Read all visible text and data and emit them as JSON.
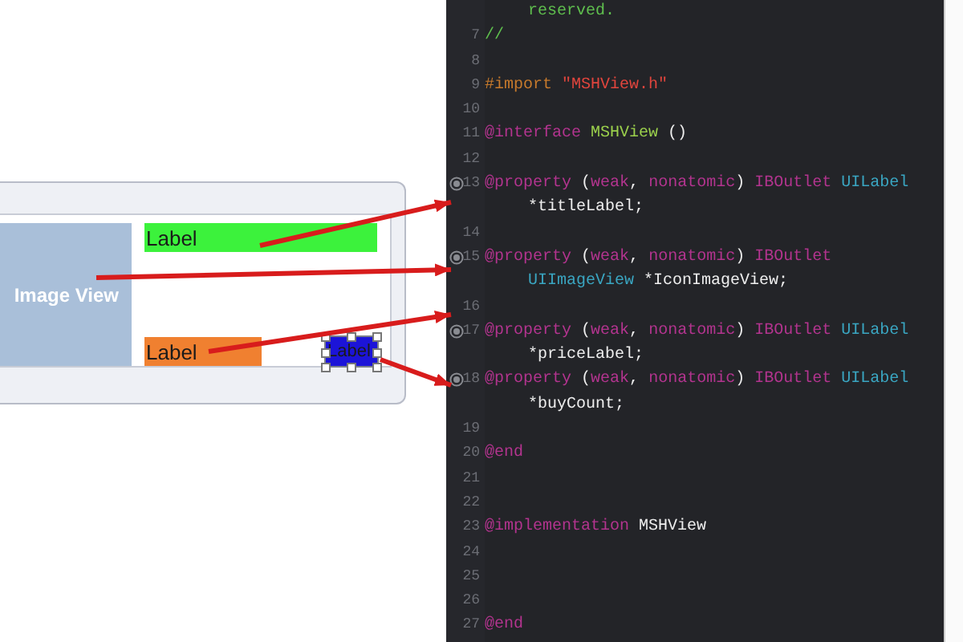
{
  "canvas": {
    "image_view": {
      "label": "Image View"
    },
    "labels": [
      {
        "text": "Label",
        "color": "#3cf23c",
        "selected": false
      },
      {
        "text": "Label",
        "color": "#f08030",
        "selected": false
      },
      {
        "text": "Label",
        "color": "#1c14d8",
        "selected": true
      }
    ]
  },
  "editor": {
    "lines": [
      {
        "connected": false,
        "tokens": [
          {
            "text": "reserved.",
            "kind": "comment"
          }
        ]
      },
      {
        "number": "7",
        "connected": false,
        "tokens": [
          {
            "text": "//",
            "kind": "comment"
          }
        ]
      },
      {
        "number": "8",
        "connected": false
      },
      {
        "number": "9",
        "connected": false,
        "tokens": [
          {
            "text": "#import ",
            "kind": "preprocessor"
          },
          {
            "text": "\"MSHView.h\"",
            "kind": "string"
          }
        ]
      },
      {
        "number": "10",
        "connected": false
      },
      {
        "number": "11",
        "connected": false,
        "tokens": [
          {
            "text": "@interface ",
            "kind": "keyword"
          },
          {
            "text": "MSHView",
            "kind": "class"
          },
          {
            "text": " ()",
            "kind": "plain"
          }
        ]
      },
      {
        "number": "12",
        "connected": false
      },
      {
        "number": "13",
        "connected": true,
        "tokens": [
          {
            "text": "@property ",
            "kind": "keyword"
          },
          {
            "text": "(",
            "kind": "plain"
          },
          {
            "text": "weak",
            "kind": "keyword"
          },
          {
            "text": ", ",
            "kind": "plain"
          },
          {
            "text": "nonatomic",
            "kind": "keyword"
          },
          {
            "text": ") ",
            "kind": "plain"
          },
          {
            "text": "IBOutlet ",
            "kind": "keyword"
          },
          {
            "text": "UILabel",
            "kind": "type"
          }
        ]
      },
      {
        "connected": false,
        "tokens": [
          {
            "text": "*titleLabel;",
            "kind": "plain"
          }
        ]
      },
      {
        "number": "14",
        "connected": false
      },
      {
        "number": "15",
        "connected": true,
        "tokens": [
          {
            "text": "@property ",
            "kind": "keyword"
          },
          {
            "text": "(",
            "kind": "plain"
          },
          {
            "text": "weak",
            "kind": "keyword"
          },
          {
            "text": ", ",
            "kind": "plain"
          },
          {
            "text": "nonatomic",
            "kind": "keyword"
          },
          {
            "text": ") ",
            "kind": "plain"
          },
          {
            "text": "IBOutlet",
            "kind": "keyword"
          }
        ]
      },
      {
        "connected": false,
        "tokens": [
          {
            "text": "UIImageView ",
            "kind": "type"
          },
          {
            "text": "*IconImageView;",
            "kind": "plain"
          }
        ]
      },
      {
        "number": "16",
        "connected": false
      },
      {
        "number": "17",
        "connected": true,
        "tokens": [
          {
            "text": "@property ",
            "kind": "keyword"
          },
          {
            "text": "(",
            "kind": "plain"
          },
          {
            "text": "weak",
            "kind": "keyword"
          },
          {
            "text": ", ",
            "kind": "plain"
          },
          {
            "text": "nonatomic",
            "kind": "keyword"
          },
          {
            "text": ") ",
            "kind": "plain"
          },
          {
            "text": "IBOutlet ",
            "kind": "keyword"
          },
          {
            "text": "UILabel",
            "kind": "type"
          }
        ]
      },
      {
        "connected": false,
        "tokens": [
          {
            "text": "*priceLabel;",
            "kind": "plain"
          }
        ]
      },
      {
        "number": "18",
        "connected": true,
        "tokens": [
          {
            "text": "@property ",
            "kind": "keyword"
          },
          {
            "text": "(",
            "kind": "plain"
          },
          {
            "text": "weak",
            "kind": "keyword"
          },
          {
            "text": ", ",
            "kind": "plain"
          },
          {
            "text": "nonatomic",
            "kind": "keyword"
          },
          {
            "text": ") ",
            "kind": "plain"
          },
          {
            "text": "IBOutlet ",
            "kind": "keyword"
          },
          {
            "text": "UILabel",
            "kind": "type"
          }
        ]
      },
      {
        "connected": false,
        "tokens": [
          {
            "text": "*buyCount;",
            "kind": "plain"
          }
        ]
      },
      {
        "number": "19",
        "connected": false
      },
      {
        "number": "20",
        "connected": false,
        "tokens": [
          {
            "text": "@end",
            "kind": "keyword"
          }
        ]
      },
      {
        "number": "21",
        "connected": false
      },
      {
        "number": "22",
        "connected": false
      },
      {
        "number": "23",
        "connected": false,
        "tokens": [
          {
            "text": "@implementation ",
            "kind": "keyword"
          },
          {
            "text": "MSHView",
            "kind": "plain"
          }
        ]
      },
      {
        "number": "24",
        "connected": false
      },
      {
        "number": "25",
        "connected": false
      },
      {
        "number": "26",
        "connected": false
      },
      {
        "number": "27",
        "connected": false,
        "tokens": [
          {
            "text": "@end",
            "kind": "keyword"
          }
        ]
      }
    ]
  }
}
